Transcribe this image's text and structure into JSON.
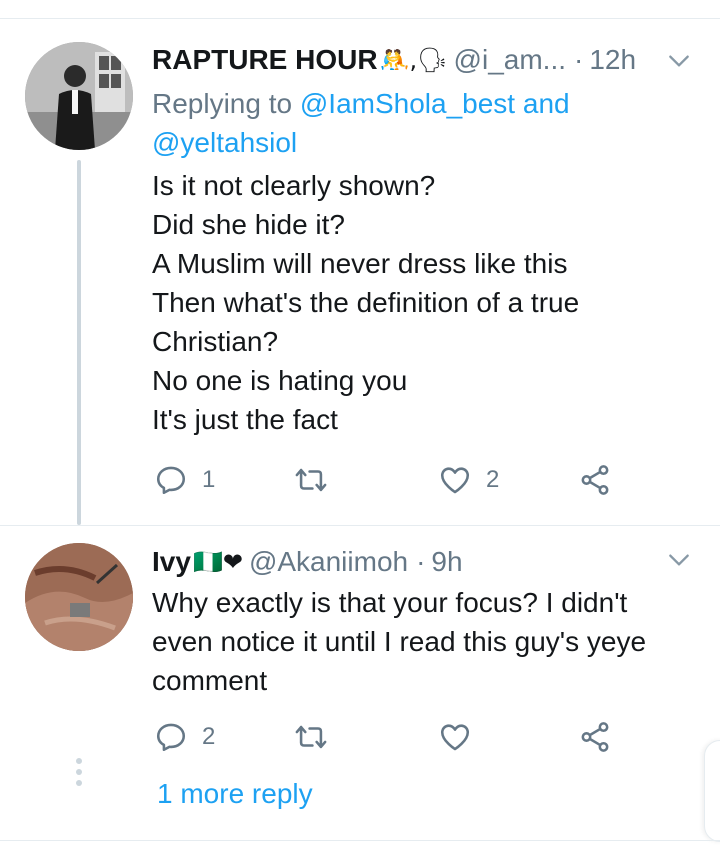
{
  "tweets": [
    {
      "display_name": "RAPTURE HOUR",
      "emoji": "🤼,🗣",
      "handle": "@i_am...",
      "separator": "·",
      "time": "12h",
      "replying_prefix": "Replying to",
      "replying_to_1": "@IamShola_best",
      "replying_and": "and",
      "replying_to_2": "@yeltahsiol",
      "lines": [
        "Is it not clearly shown?",
        "Did she hide it?",
        "A Muslim will never dress like this",
        "Then what's the definition of a true Christian?",
        "No one is hating you",
        "It's just the fact"
      ],
      "reply_count": "1",
      "retweet_count": "",
      "like_count": "2"
    },
    {
      "display_name": "Ivy",
      "emoji": "🇳🇬❤",
      "handle": "@Akaniimoh",
      "separator": "·",
      "time": "9h",
      "lines": [
        "Why exactly is that your focus? I didn't even notice it until I read this guy's yeye comment"
      ],
      "reply_count": "2",
      "retweet_count": "",
      "like_count": ""
    }
  ],
  "more_replies_label": "1 more reply",
  "colors": {
    "link_blue": "#1da1f2",
    "secondary_gray": "#657786",
    "thread_line": "#ccd6dd",
    "divider": "#e6ecf0"
  },
  "icons": [
    "reply-icon",
    "retweet-icon",
    "like-icon",
    "share-icon",
    "chevron-down-icon"
  ]
}
